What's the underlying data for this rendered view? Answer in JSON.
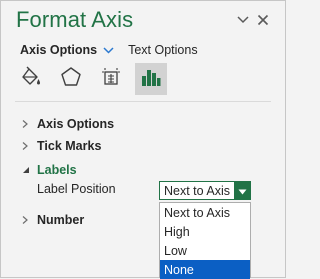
{
  "pane": {
    "title": "Format Axis",
    "subtabs": {
      "options": "Axis Options",
      "text": "Text Options"
    },
    "categories": [
      {
        "icon": "fill-line-icon",
        "active": false
      },
      {
        "icon": "effects-pentagon-icon",
        "active": false
      },
      {
        "icon": "size-properties-icon",
        "active": false
      },
      {
        "icon": "axis-options-chart-icon",
        "active": true
      }
    ]
  },
  "sections": {
    "axis_options": "Axis Options",
    "tick_marks": "Tick Marks",
    "labels": "Labels",
    "number": "Number"
  },
  "labels": {
    "field_label": "Label Position",
    "selected": "Next to Axis",
    "options": [
      "Next to Axis",
      "High",
      "Low",
      "None"
    ],
    "highlighted": "None"
  },
  "colors": {
    "accent": "#217346",
    "highlight": "#0b5fc4",
    "pane_bg": "#f3f3f3"
  }
}
